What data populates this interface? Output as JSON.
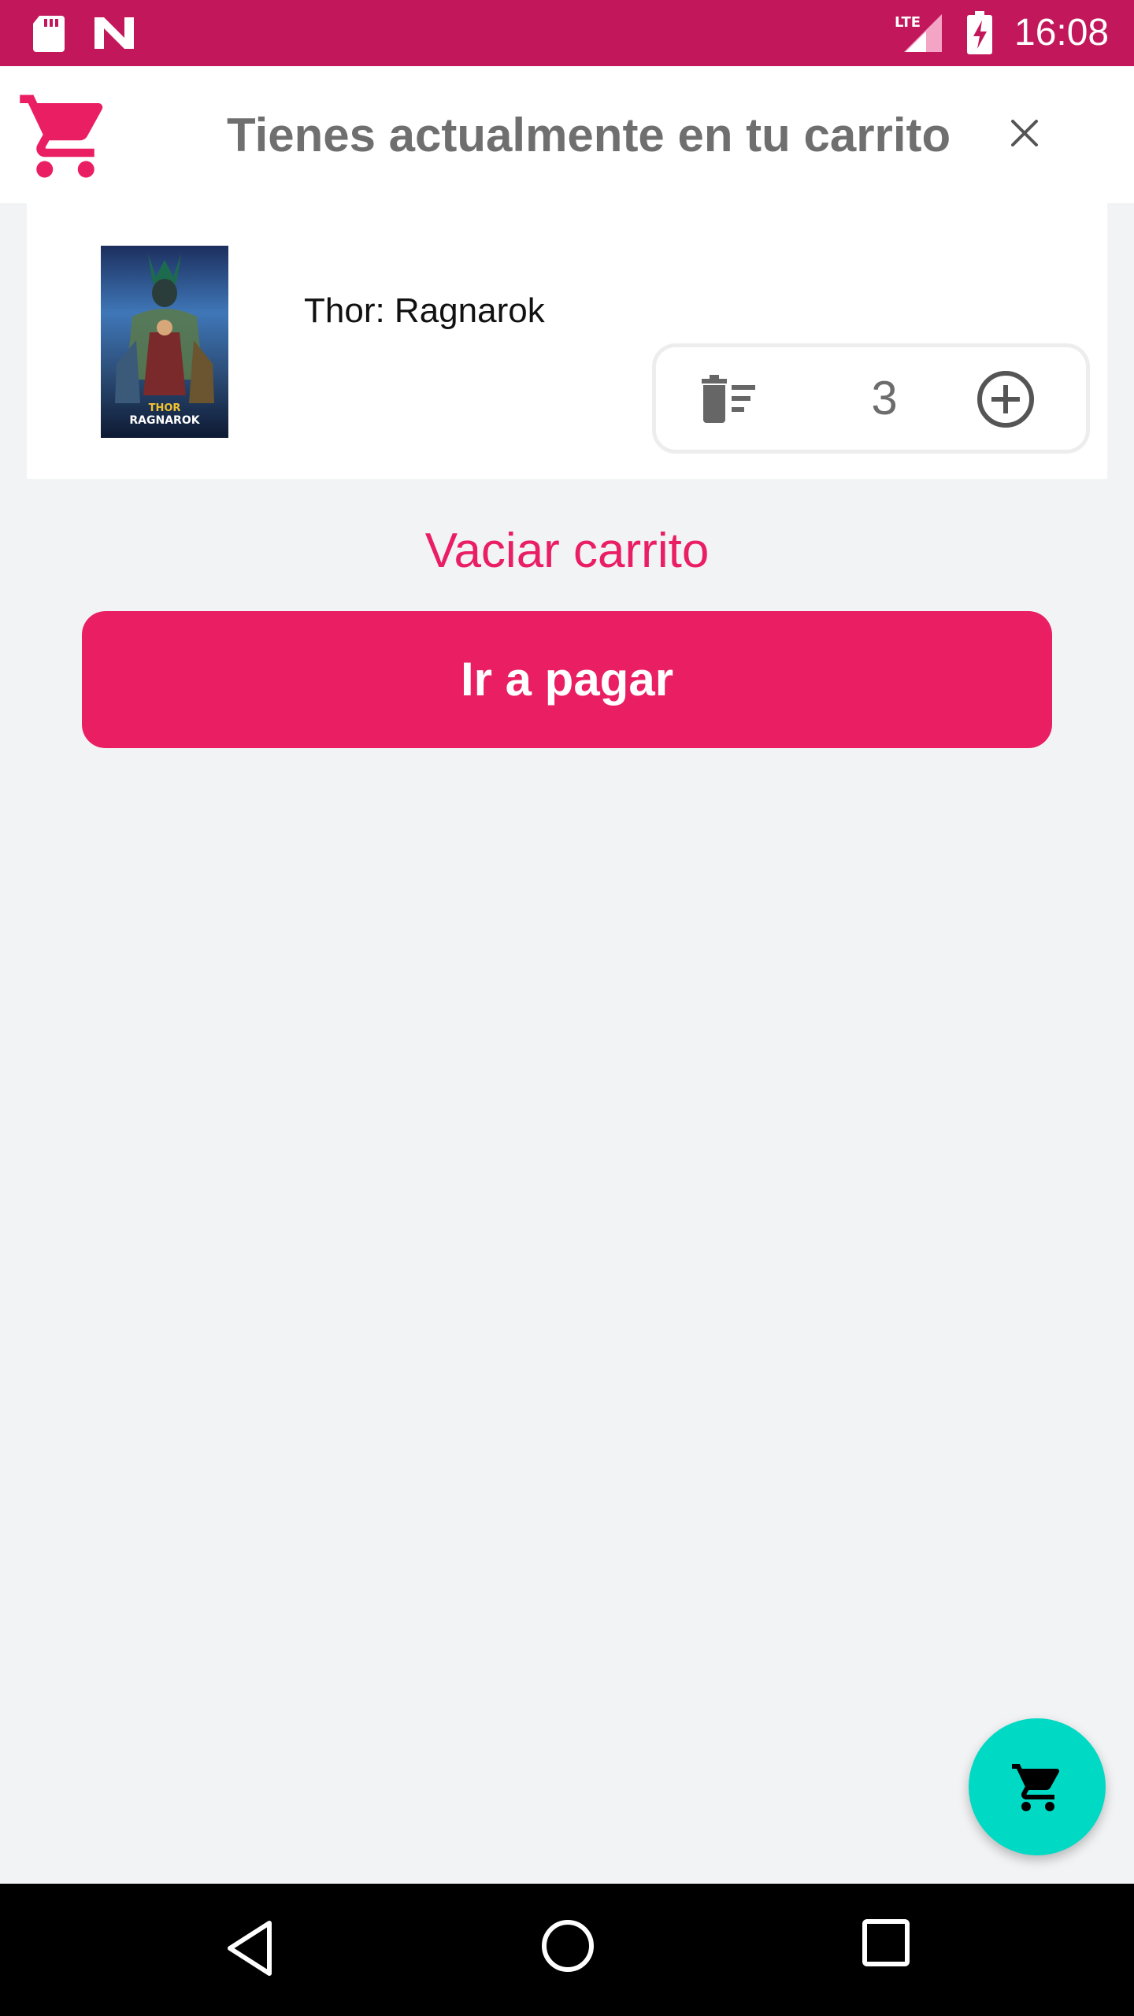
{
  "status_bar": {
    "time": "16:08",
    "network": "LTE",
    "icons": [
      "sd-card-icon",
      "n-logo-icon",
      "lte-signal-icon",
      "battery-charging-icon"
    ]
  },
  "header": {
    "title": "Tienes actualmente en tu carrito",
    "icons": [
      "shopping-cart-icon",
      "close-icon"
    ]
  },
  "cart_items": [
    {
      "title": "Thor: Ragnarok",
      "poster_text": [
        "THOR",
        "RAGNAROK"
      ],
      "quantity": "3"
    }
  ],
  "actions": {
    "empty_cart": "Vaciar carrito",
    "checkout": "Ir a pagar"
  },
  "colors": {
    "status_bar": "#c2185b",
    "accent": "#e91e63",
    "fab": "#00d9c4",
    "background": "#f2f3f5"
  }
}
